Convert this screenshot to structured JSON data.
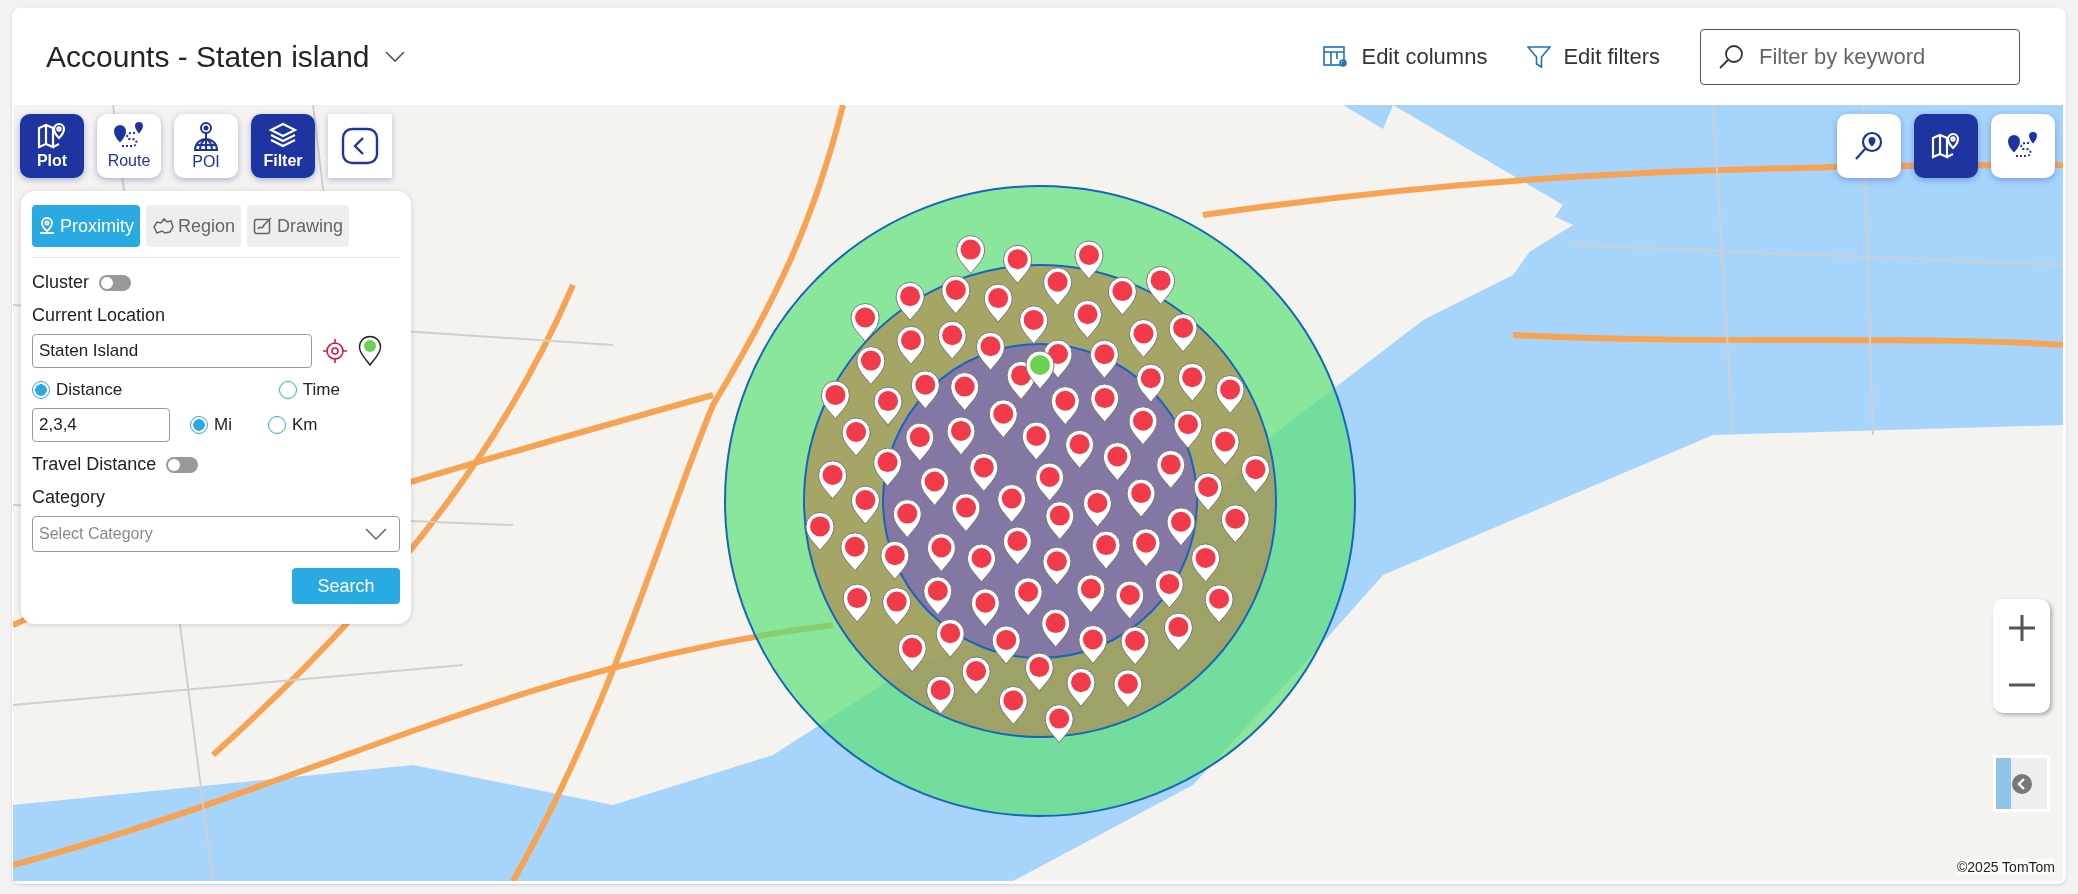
{
  "header": {
    "title": "Accounts - Staten island",
    "actions": [
      {
        "label": "Edit columns",
        "kind": "columns"
      },
      {
        "label": "Edit filters",
        "kind": "filter"
      }
    ],
    "search": {
      "placeholder": "Filter by keyword"
    }
  },
  "toolbar": [
    {
      "label": "Plot",
      "kind": "plot",
      "selected": true
    },
    {
      "label": "Route",
      "kind": "route",
      "selected": false
    },
    {
      "label": "POI",
      "kind": "poi",
      "selected": false
    },
    {
      "label": "Filter",
      "kind": "filter",
      "selected": true
    }
  ],
  "right_toolbar": [
    {
      "kind": "search-location",
      "selected": false
    },
    {
      "kind": "map",
      "selected": true
    },
    {
      "kind": "route",
      "selected": false
    }
  ],
  "panel": {
    "tabs": [
      {
        "label": "Proximity",
        "kind": "pin",
        "selected": true
      },
      {
        "label": "Region",
        "kind": "region",
        "selected": false
      },
      {
        "label": "Drawing",
        "kind": "drawing",
        "selected": false
      }
    ],
    "cluster": {
      "label": "Cluster",
      "on": false
    },
    "location": {
      "label": "Current Location",
      "value": "Staten Island"
    },
    "modes": [
      {
        "label": "Distance",
        "selected": true
      },
      {
        "label": "Time",
        "selected": false
      }
    ],
    "distances": {
      "value": "2,3,4"
    },
    "units": [
      {
        "label": "Mi",
        "selected": true
      },
      {
        "label": "Km",
        "selected": false
      }
    ],
    "travel_distance": {
      "label": "Travel Distance",
      "on": false
    },
    "category": {
      "label": "Category",
      "placeholder": "Select Category"
    },
    "search_button": "Search"
  },
  "map": {
    "attribution": "©2025 TomTom"
  }
}
